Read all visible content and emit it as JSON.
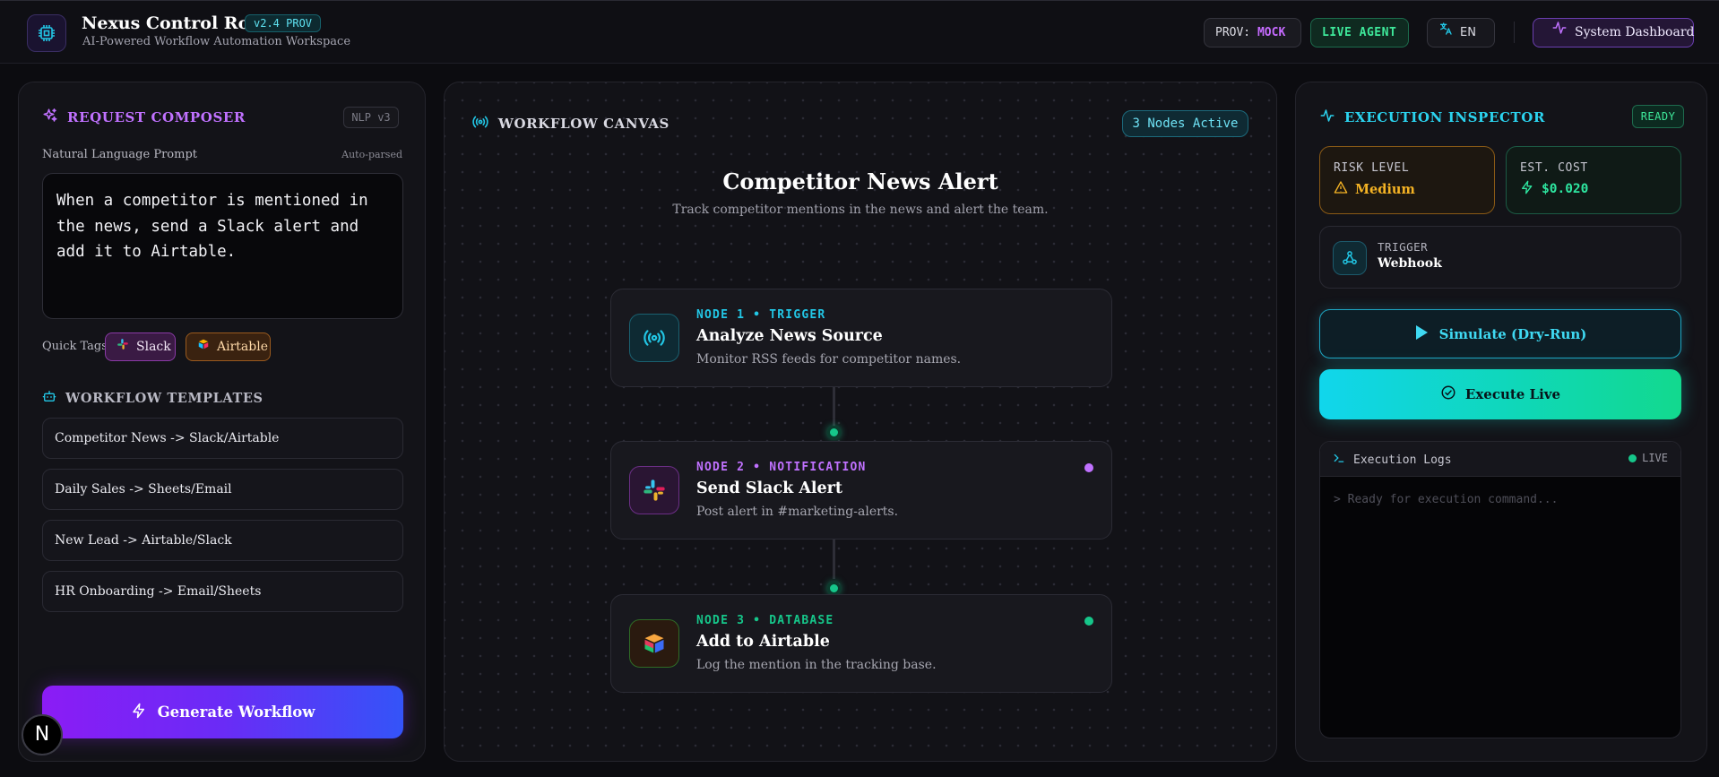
{
  "header": {
    "title": "Nexus Control Room",
    "version": "v2.4 PROV",
    "subtitle": "AI-Powered Workflow Automation Workspace",
    "prov_prefix": "PROV:",
    "prov_value": "MOCK",
    "live_agent": "LIVE AGENT",
    "language": "EN",
    "system_dashboard": "System Dashboard"
  },
  "composer": {
    "title": "REQUEST COMPOSER",
    "badge": "NLP v3",
    "prompt_label": "Natural Language Prompt",
    "auto_parsed": "Auto-parsed",
    "prompt_text": "When a competitor is mentioned in the news, send a Slack alert and add it to Airtable.",
    "quick_tags_label": "Quick Tags:",
    "quick_tags": [
      "Slack",
      "Airtable"
    ],
    "templates_title": "WORKFLOW TEMPLATES",
    "templates": [
      "Competitor News -> Slack/Airtable",
      "Daily Sales -> Sheets/Email",
      "New Lead -> Airtable/Slack",
      "HR Onboarding -> Email/Sheets"
    ],
    "generate_button": "Generate Workflow",
    "n_badge": "N"
  },
  "canvas": {
    "title": "WORKFLOW CANVAS",
    "nodes_active": "3 Nodes Active",
    "workflow_title": "Competitor News Alert",
    "workflow_desc": "Track competitor mentions in the news and alert the team.",
    "nodes": [
      {
        "kicker": "NODE 1 • TRIGGER",
        "name": "Analyze News Source",
        "desc": "Monitor RSS feeds for competitor names.",
        "color": "#22c7e6",
        "icon": "broadcast-icon"
      },
      {
        "kicker": "NODE 2 • NOTIFICATION",
        "name": "Send Slack Alert",
        "desc": "Post alert in #marketing-alerts.",
        "color": "#c071ff",
        "icon": "slack-icon"
      },
      {
        "kicker": "NODE 3 • DATABASE",
        "name": "Add to Airtable",
        "desc": "Log the mention in the tracking base.",
        "color": "#16c68a",
        "icon": "airtable-icon"
      }
    ]
  },
  "inspector": {
    "title": "EXECUTION INSPECTOR",
    "status": "READY",
    "risk_label": "RISK LEVEL",
    "risk_value": "Medium",
    "cost_label": "EST. COST",
    "cost_value": "$0.020",
    "trigger_label": "TRIGGER",
    "trigger_value": "Webhook",
    "simulate_button": "Simulate (Dry-Run)",
    "execute_button": "Execute Live",
    "logs_title": "Execution Logs",
    "logs_live": "LIVE",
    "logs_line": "> Ready for execution command..."
  },
  "colors": {
    "accent_purple": "#c071ff",
    "accent_cyan": "#22c7e6",
    "accent_green": "#16c68a",
    "warning_orange": "#f5b324"
  }
}
